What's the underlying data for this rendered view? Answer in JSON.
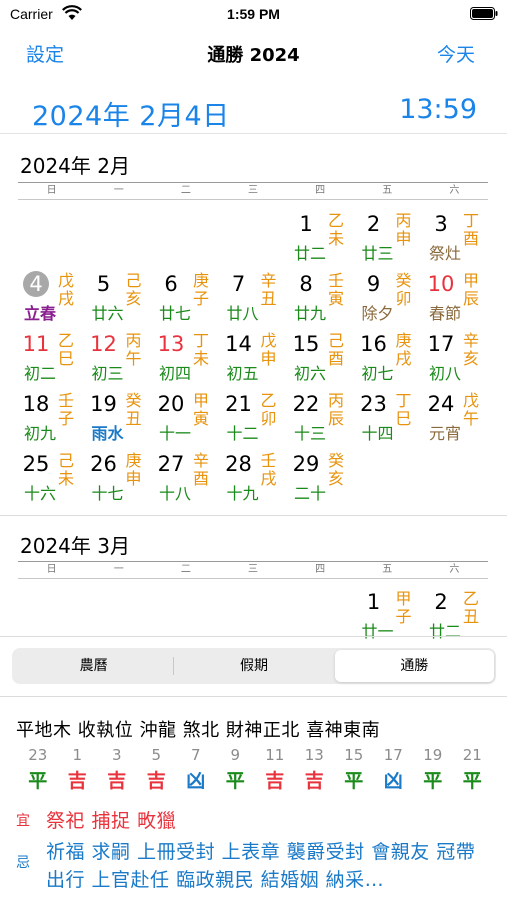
{
  "status": {
    "carrier": "Carrier",
    "time": "1:59 PM"
  },
  "nav": {
    "left": "設定",
    "title": "通勝 2024",
    "right": "今天"
  },
  "header": {
    "date": "2024年 2月4日",
    "time": "13:59"
  },
  "weekdays": [
    "日",
    "一",
    "二",
    "三",
    "四",
    "五",
    "六"
  ],
  "month1": {
    "title": "2024年 2月",
    "days": [
      {
        "d": "1",
        "gz": "乙未",
        "lunar": "廿二",
        "t": ""
      },
      {
        "d": "2",
        "gz": "丙申",
        "lunar": "廿三",
        "t": ""
      },
      {
        "d": "3",
        "gz": "丁酉",
        "lunar": "祭灶",
        "t": "fest"
      },
      {
        "d": "4",
        "gz": "戊戌",
        "lunar": "立春",
        "t": "term",
        "today": true
      },
      {
        "d": "5",
        "gz": "己亥",
        "lunar": "廿六",
        "t": ""
      },
      {
        "d": "6",
        "gz": "庚子",
        "lunar": "廿七",
        "t": ""
      },
      {
        "d": "7",
        "gz": "辛丑",
        "lunar": "廿八",
        "t": ""
      },
      {
        "d": "8",
        "gz": "壬寅",
        "lunar": "廿九",
        "t": ""
      },
      {
        "d": "9",
        "gz": "癸卯",
        "lunar": "除夕",
        "t": "fest"
      },
      {
        "d": "10",
        "gz": "甲辰",
        "lunar": "春節",
        "t": "fest",
        "red": true
      },
      {
        "d": "11",
        "gz": "乙巳",
        "lunar": "初二",
        "t": "",
        "red": true
      },
      {
        "d": "12",
        "gz": "丙午",
        "lunar": "初三",
        "t": "",
        "red": true
      },
      {
        "d": "13",
        "gz": "丁未",
        "lunar": "初四",
        "t": "",
        "red": true
      },
      {
        "d": "14",
        "gz": "戊申",
        "lunar": "初五",
        "t": ""
      },
      {
        "d": "15",
        "gz": "己酉",
        "lunar": "初六",
        "t": ""
      },
      {
        "d": "16",
        "gz": "庚戌",
        "lunar": "初七",
        "t": ""
      },
      {
        "d": "17",
        "gz": "辛亥",
        "lunar": "初八",
        "t": ""
      },
      {
        "d": "18",
        "gz": "壬子",
        "lunar": "初九",
        "t": ""
      },
      {
        "d": "19",
        "gz": "癸丑",
        "lunar": "雨水",
        "t": "rain"
      },
      {
        "d": "20",
        "gz": "甲寅",
        "lunar": "十一",
        "t": ""
      },
      {
        "d": "21",
        "gz": "乙卯",
        "lunar": "十二",
        "t": ""
      },
      {
        "d": "22",
        "gz": "丙辰",
        "lunar": "十三",
        "t": ""
      },
      {
        "d": "23",
        "gz": "丁巳",
        "lunar": "十四",
        "t": ""
      },
      {
        "d": "24",
        "gz": "戊午",
        "lunar": "元宵",
        "t": "fest"
      },
      {
        "d": "25",
        "gz": "己未",
        "lunar": "十六",
        "t": ""
      },
      {
        "d": "26",
        "gz": "庚申",
        "lunar": "十七",
        "t": ""
      },
      {
        "d": "27",
        "gz": "辛酉",
        "lunar": "十八",
        "t": ""
      },
      {
        "d": "28",
        "gz": "壬戌",
        "lunar": "十九",
        "t": ""
      },
      {
        "d": "29",
        "gz": "癸亥",
        "lunar": "二十",
        "t": ""
      }
    ]
  },
  "month2": {
    "title": "2024年 3月",
    "days": [
      {
        "d": "1",
        "gz": "甲子",
        "lunar": "廿一",
        "t": ""
      },
      {
        "d": "2",
        "gz": "乙丑",
        "lunar": "廿二",
        "t": ""
      }
    ]
  },
  "tabs": [
    "農曆",
    "假期",
    "通勝"
  ],
  "info": "平地木 收執位 沖龍 煞北 財神正北 喜神東南",
  "hours": [
    {
      "n": "23",
      "v": "平",
      "c": "green"
    },
    {
      "n": "1",
      "v": "吉",
      "c": "red"
    },
    {
      "n": "3",
      "v": "吉",
      "c": "red"
    },
    {
      "n": "5",
      "v": "吉",
      "c": "red"
    },
    {
      "n": "7",
      "v": "凶",
      "c": "blue"
    },
    {
      "n": "9",
      "v": "平",
      "c": "green"
    },
    {
      "n": "11",
      "v": "吉",
      "c": "red"
    },
    {
      "n": "13",
      "v": "吉",
      "c": "red"
    },
    {
      "n": "15",
      "v": "平",
      "c": "green"
    },
    {
      "n": "17",
      "v": "凶",
      "c": "blue"
    },
    {
      "n": "19",
      "v": "平",
      "c": "green"
    },
    {
      "n": "21",
      "v": "平",
      "c": "green"
    }
  ],
  "yi": {
    "label": "宜",
    "text": "祭祀 捕捉 畋獵"
  },
  "ji": {
    "label": "忌",
    "text": "祈福 求嗣 上冊受封 上表章 襲爵受封 會親友 冠帶 出行 上官赴任 臨政親民 結婚姻 納采…"
  },
  "colors": {
    "accent": "#1a84e8",
    "ganzhi": "#e8930e",
    "lunar": "#1a8a1a",
    "holiday": "#e8323c",
    "solar_term": "#8a2090"
  }
}
